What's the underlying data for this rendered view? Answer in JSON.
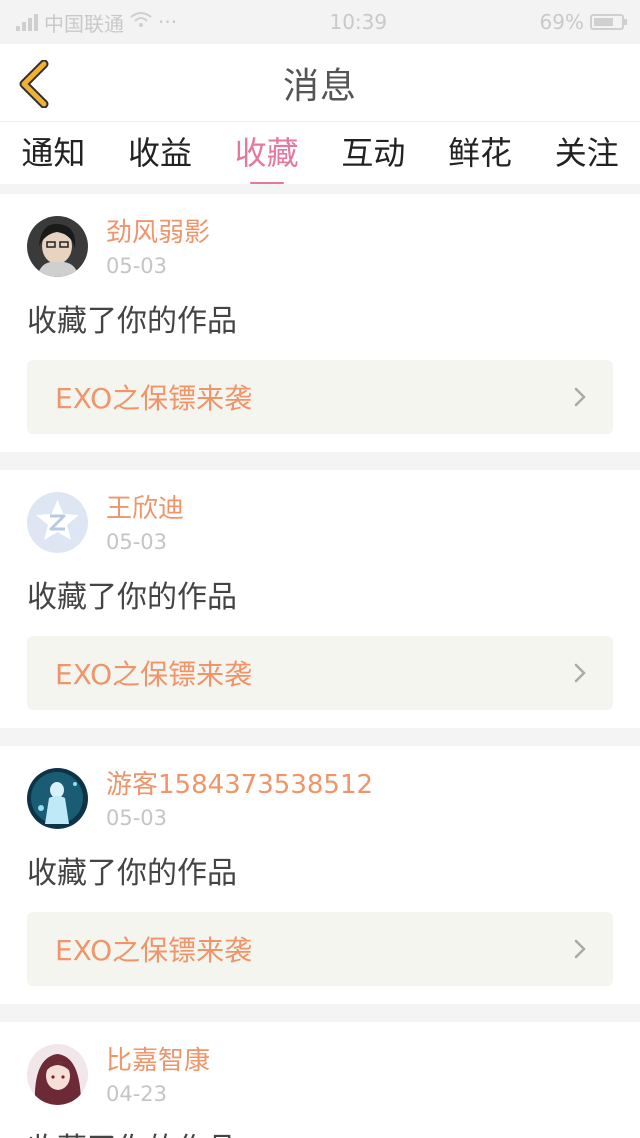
{
  "status_bar": {
    "carrier": "中国联通",
    "time": "10:39",
    "battery": "69%"
  },
  "header": {
    "title": "消息",
    "back_icon": "chevron-left-icon",
    "accent": "#f2b035"
  },
  "tabs": [
    {
      "label": "通知",
      "active": false
    },
    {
      "label": "收益",
      "active": false
    },
    {
      "label": "收藏",
      "active": true
    },
    {
      "label": "互动",
      "active": false
    },
    {
      "label": "鲜花",
      "active": false
    },
    {
      "label": "关注",
      "active": false
    }
  ],
  "colors": {
    "active_tab": "#e4789e",
    "username": "#f0946a",
    "date": "#c5c5c5",
    "card_link_bg": "#f5f5ef"
  },
  "messages": [
    {
      "username": "劲风弱影",
      "date": "05-03",
      "action": "收藏了你的作品",
      "work_title": "EXO之保镖来袭"
    },
    {
      "username": "王欣迪",
      "date": "05-03",
      "action": "收藏了你的作品",
      "work_title": "EXO之保镖来袭"
    },
    {
      "username": "游客1584373538512",
      "date": "05-03",
      "action": "收藏了你的作品",
      "work_title": "EXO之保镖来袭"
    },
    {
      "username": "比嘉智康",
      "date": "04-23",
      "action": "收藏了你的作品",
      "work_title": ""
    }
  ]
}
